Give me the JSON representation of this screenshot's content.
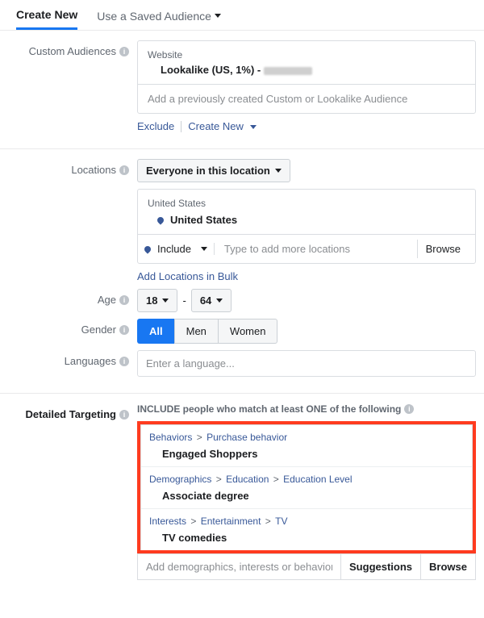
{
  "tabs": {
    "create_new": "Create New",
    "saved": "Use a Saved Audience"
  },
  "custom_audiences": {
    "label": "Custom Audiences",
    "website_label": "Website",
    "lookalike_text": "Lookalike (US, 1%) -",
    "add_placeholder": "Add a previously created Custom or Lookalike Audience",
    "exclude": "Exclude",
    "create_new": "Create New"
  },
  "locations": {
    "label": "Locations",
    "scope": "Everyone in this location",
    "country_header": "United States",
    "country_item": "United States",
    "include": "Include",
    "input_placeholder": "Type to add more locations",
    "browse": "Browse",
    "bulk": "Add Locations in Bulk"
  },
  "age": {
    "label": "Age",
    "min": "18",
    "sep": "-",
    "max": "64"
  },
  "gender": {
    "label": "Gender",
    "options": [
      "All",
      "Men",
      "Women"
    ],
    "selected": "All"
  },
  "languages": {
    "label": "Languages",
    "placeholder": "Enter a language..."
  },
  "detailed_targeting": {
    "label": "Detailed Targeting",
    "include_head": "INCLUDE people who match at least ONE of the following",
    "groups": [
      {
        "crumbs": [
          "Behaviors",
          "Purchase behavior"
        ],
        "item": "Engaged Shoppers"
      },
      {
        "crumbs": [
          "Demographics",
          "Education",
          "Education Level"
        ],
        "item": "Associate degree"
      },
      {
        "crumbs": [
          "Interests",
          "Entertainment",
          "TV"
        ],
        "item": "TV comedies"
      }
    ],
    "add_placeholder": "Add demographics, interests or behaviors",
    "suggestions": "Suggestions",
    "browse": "Browse"
  }
}
